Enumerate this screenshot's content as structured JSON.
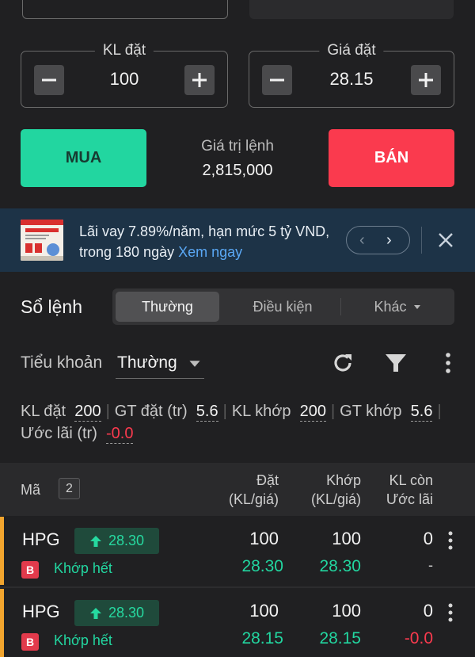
{
  "order_form": {
    "quantity": {
      "label": "KL đặt",
      "value": "100"
    },
    "price": {
      "label": "Giá đặt",
      "value": "28.15"
    },
    "buy_label": "MUA",
    "sell_label": "BÁN",
    "order_value_label": "Giá trị lệnh",
    "order_value": "2,815,000"
  },
  "banner": {
    "text": "Lãi vay 7.89%/năm, hạn mức 5 tỷ VND, trong 180 ngày",
    "link": "Xem ngay"
  },
  "order_book": {
    "title": "Sổ lệnh",
    "tabs": [
      {
        "label": "Thường",
        "active": true
      },
      {
        "label": "Điều kiện",
        "active": false
      },
      {
        "label": "Khác",
        "active": false
      }
    ],
    "subaccount_label": "Tiểu khoản",
    "subaccount_value": "Thường",
    "summary": {
      "kl_dat_label": "KL đặt",
      "kl_dat_value": "200",
      "gt_dat_label": "GT đặt (tr)",
      "gt_dat_value": "5.6",
      "kl_khop_label": "KL khớp",
      "kl_khop_value": "200",
      "gt_khop_label_1": "GT",
      "gt_khop_label_2": "khớp",
      "gt_khop_value": "5.6",
      "uoc_lai_label": "Ước lãi (tr)",
      "uoc_lai_value": "-0.0"
    },
    "columns": {
      "symbol": "Mã",
      "count": "2",
      "placed_1": "Đặt",
      "placed_2": "(KL/giá)",
      "matched_1": "Khớp",
      "matched_2": "(KL/giá)",
      "remaining_1": "KL còn",
      "remaining_2": "Ước lãi"
    },
    "rows": [
      {
        "symbol": "HPG",
        "price_badge": "28.30",
        "side": "B",
        "status": "Khớp hết",
        "placed_qty": "100",
        "placed_price": "28.30",
        "matched_qty": "100",
        "matched_price": "28.30",
        "remaining": "0",
        "profit": "-"
      },
      {
        "symbol": "HPG",
        "price_badge": "28.30",
        "side": "B",
        "status": "Khớp hết",
        "placed_qty": "100",
        "placed_price": "28.15",
        "matched_qty": "100",
        "matched_price": "28.15",
        "remaining": "0",
        "profit": "-0.0"
      }
    ]
  },
  "colors": {
    "buy": "#22d6a0",
    "sell": "#fa3a4e",
    "banner_bg": "#1d3347",
    "link": "#5aa8f5",
    "row_accent": "#f2a52e"
  },
  "icons": [
    "minus-icon",
    "plus-icon",
    "chevron-left-icon",
    "chevron-right-icon",
    "close-icon",
    "refresh-icon",
    "filter-icon",
    "kebab-menu-icon",
    "caret-down-icon",
    "arrow-up-icon"
  ]
}
